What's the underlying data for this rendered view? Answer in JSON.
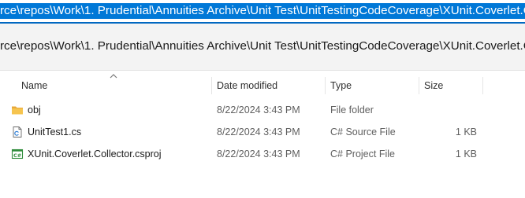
{
  "address_bar": {
    "text": "rce\\repos\\Work\\1. Prudential\\Annuities Archive\\Unit Test\\UnitTestingCodeCoverage\\XUnit.Coverlet.Collector",
    "selection_color": "#0078d7"
  },
  "suggestions": [
    {
      "text": "rce\\repos\\Work\\1. Prudential\\Annuities Archive\\Unit Test\\UnitTestingCodeCoverage\\XUnit.Coverlet.Collector"
    }
  ],
  "columns": {
    "name": "Name",
    "date_modified": "Date modified",
    "type": "Type",
    "size": "Size",
    "sort": "ascending"
  },
  "files": [
    {
      "name": "obj",
      "date_modified": "8/22/2024 3:43 PM",
      "type": "File folder",
      "size": "",
      "icon": "folder-icon"
    },
    {
      "name": "UnitTest1.cs",
      "date_modified": "8/22/2024 3:43 PM",
      "type": "C# Source File",
      "size": "1 KB",
      "icon": "csharp-source-icon"
    },
    {
      "name": "XUnit.Coverlet.Collector.csproj",
      "date_modified": "8/22/2024 3:43 PM",
      "type": "C# Project File",
      "size": "1 KB",
      "icon": "csharp-project-icon"
    }
  ],
  "colors": {
    "accent": "#0067c0",
    "folder": "#f3c14b",
    "csharp_project": "#2e8b3a"
  }
}
